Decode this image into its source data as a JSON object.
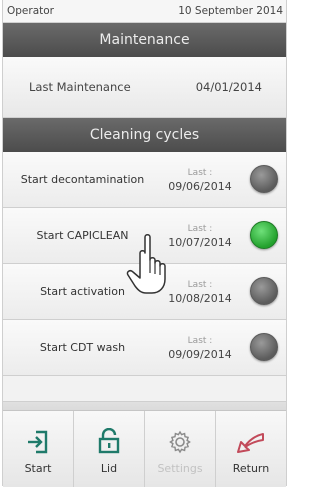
{
  "status": {
    "operator": "Operator",
    "date": "10 September 2014"
  },
  "maintenance": {
    "header": "Maintenance",
    "last_label": "Last Maintenance",
    "last_date": "04/01/2014"
  },
  "cleaning": {
    "header": "Cleaning cycles",
    "cycles": [
      {
        "label": "Start decontamination",
        "last_label": "Last :",
        "last_date": "09/06/2014",
        "status": "grey"
      },
      {
        "label": "Start CAPICLEAN",
        "last_label": "Last :",
        "last_date": "10/07/2014",
        "status": "green"
      },
      {
        "label": "Start activation",
        "last_label": "Last :",
        "last_date": "10/08/2014",
        "status": "grey"
      },
      {
        "label": "Start CDT wash",
        "last_label": "Last :",
        "last_date": "09/09/2014",
        "status": "grey"
      }
    ]
  },
  "toolbar": {
    "start": "Start",
    "lid": "Lid",
    "settings": "Settings",
    "return": "Return"
  },
  "colors": {
    "accent": "#1f7a6a",
    "return_icon": "#c24a5a",
    "status_green": "#2fb33a",
    "status_grey": "#707070"
  }
}
